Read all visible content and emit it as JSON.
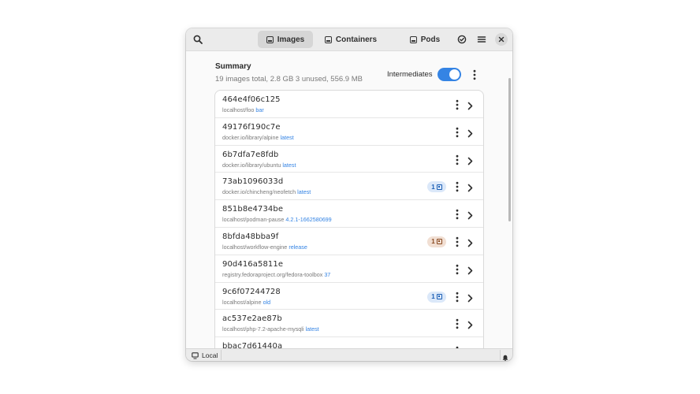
{
  "header": {
    "tabs": [
      {
        "label": "Images",
        "icon": "image-icon"
      },
      {
        "label": "Containers",
        "icon": "container-icon"
      },
      {
        "label": "Pods",
        "icon": "pod-icon"
      }
    ]
  },
  "summary": {
    "title": "Summary",
    "subtitle": "19 images total, 2.8 GB  3 unused, 556.9 MB",
    "intermediates_label": "Intermediates",
    "intermediates_on": true
  },
  "images": [
    {
      "id": "464e4f06c125",
      "repo": "localhost/foo",
      "tag": "bar",
      "containers": null
    },
    {
      "id": "49176f190c7e",
      "repo": "docker.io/library/alpine",
      "tag": "latest",
      "containers": null
    },
    {
      "id": "6b7dfa7e8fdb",
      "repo": "docker.io/library/ubuntu",
      "tag": "latest",
      "containers": null
    },
    {
      "id": "73ab1096033d",
      "repo": "docker.io/chincheng/neofetch",
      "tag": "latest",
      "containers": "1"
    },
    {
      "id": "851b8e4734be",
      "repo": "localhost/podman-pause",
      "tag": "4.2.1-1662580699",
      "containers": null
    },
    {
      "id": "8bfda48bba9f",
      "repo": "localhost/workflow-engine",
      "tag": "release",
      "containers": "1"
    },
    {
      "id": "90d416a5811e",
      "repo": "registry.fedoraproject.org/fedora-toolbox",
      "tag": "37",
      "containers": null
    },
    {
      "id": "9c6f07244728",
      "repo": "localhost/alpine",
      "tag": "old",
      "containers": "1"
    },
    {
      "id": "ac537e2ae87b",
      "repo": "localhost/php-7.2-apache-mysqli",
      "tag": "latest",
      "containers": null
    },
    {
      "id": "bbac7d61440a",
      "repo": "",
      "tag": "",
      "containers": null
    }
  ],
  "statusbar": {
    "connection_label": "Local"
  },
  "colors": {
    "accent": "#3584e4",
    "badge_blue_bg": "#dbe8f9",
    "badge_brown_bg": "#f1dfd3"
  }
}
